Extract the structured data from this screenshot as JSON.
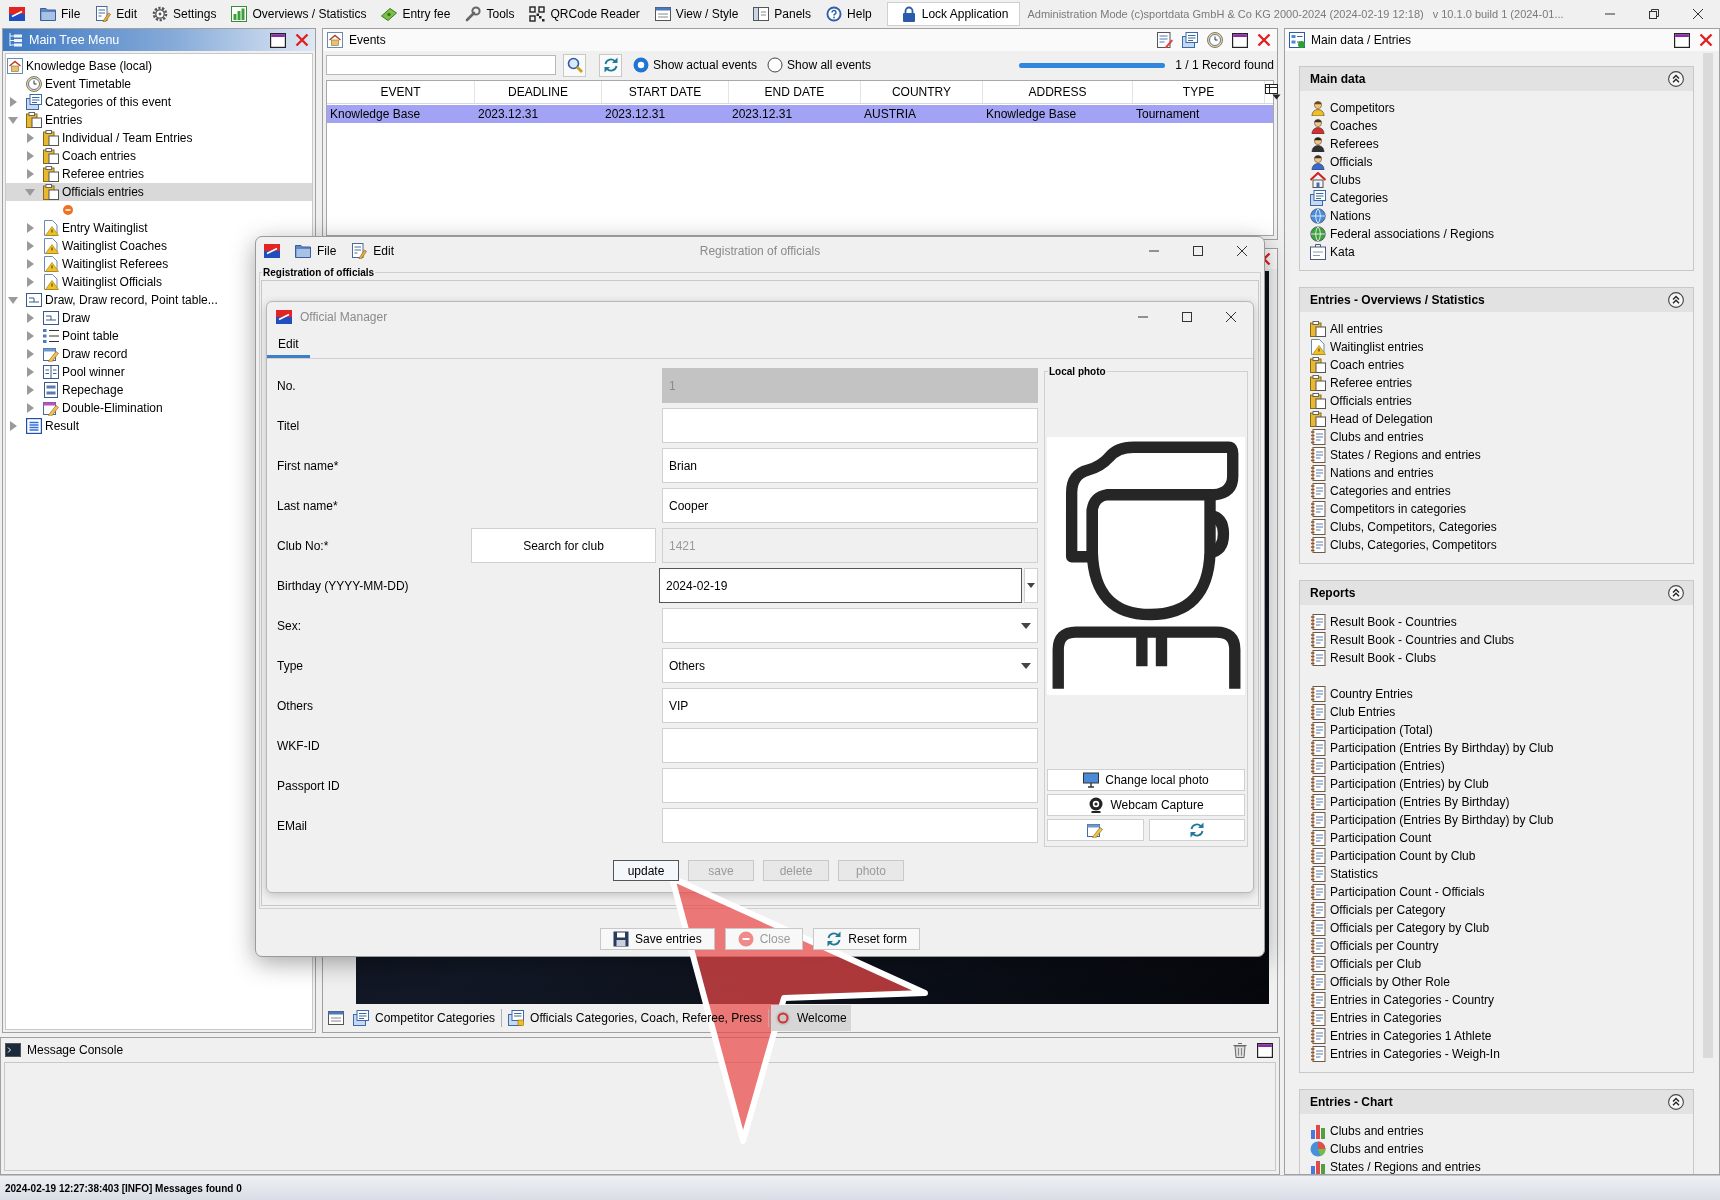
{
  "menu_bar": {
    "items": [
      "File",
      "Edit",
      "Settings",
      "Overviews / Statistics",
      "Entry fee",
      "Tools",
      "QRCode Reader",
      "View / Style",
      "Panels",
      "Help"
    ],
    "lock_button": "Lock Application",
    "mode_text": "Administration Mode (c)sportdata GmbH & Co KG 2000-2024 (2024-02-19 12:18)",
    "version_text": "v 10.1.0 build 1 (2024-01..."
  },
  "tree_panel": {
    "title": "Main Tree Menu",
    "nodes": [
      {
        "label": "Knowledge Base (local)",
        "selected": false,
        "children": [
          {
            "label": "Event Timetable",
            "selected": false
          },
          {
            "label": "Categories of this event",
            "selected": false,
            "expanded": false
          },
          {
            "label": "Entries",
            "selected": false,
            "expanded": true,
            "children": [
              {
                "label": "Individual / Team Entries",
                "selected": false,
                "expanded": false
              },
              {
                "label": "Coach entries",
                "selected": false,
                "expanded": false
              },
              {
                "label": "Referee entries",
                "selected": false,
                "expanded": false
              },
              {
                "label": "Officials entries",
                "selected": true,
                "expanded": true,
                "children": [
                  {
                    "selected": false
                  }
                ]
              },
              {
                "label": "Entry Waitinglist",
                "selected": false,
                "expanded": false
              },
              {
                "label": "Waitinglist Coaches",
                "selected": false,
                "expanded": false
              },
              {
                "label": "Waitinglist Referees",
                "selected": false,
                "expanded": false
              },
              {
                "label": "Waitinglist Officials",
                "selected": false,
                "expanded": false
              }
            ]
          },
          {
            "label": "Draw, Draw record, Point table...",
            "selected": false,
            "expanded": true,
            "children": [
              {
                "label": "Draw",
                "selected": false,
                "expanded": false
              },
              {
                "label": "Point table",
                "selected": false,
                "expanded": false
              },
              {
                "label": "Draw record",
                "selected": false,
                "expanded": false
              },
              {
                "label": "Pool winner",
                "selected": false,
                "expanded": false
              },
              {
                "label": "Repechage",
                "selected": false,
                "expanded": false
              },
              {
                "label": "Double-Elimination",
                "selected": false,
                "expanded": false
              }
            ]
          },
          {
            "label": "Result",
            "selected": false,
            "expanded": false
          }
        ]
      }
    ]
  },
  "events_panel": {
    "title": "Events",
    "radios": [
      {
        "label": "Show actual events",
        "selected": true
      },
      {
        "label": "Show all events",
        "selected": false
      }
    ],
    "progress": {
      "level": 1
    },
    "record_count": "1 / 1 Record found",
    "table": {
      "columns": [
        "EVENT",
        "DEADLINE",
        "START DATE",
        "END DATE",
        "COUNTRY",
        "ADDRESS",
        "TYPE"
      ],
      "rows": [
        {
          "cells": [
            "Knowledge Base",
            "2023.12.31",
            "2023.12.31",
            "2023.12.31",
            "AUSTRIA",
            "Knowledge Base",
            "Tournament"
          ],
          "selected": true
        }
      ]
    }
  },
  "document_tabs": [
    {
      "label": "Competitor Categories",
      "selected": false
    },
    {
      "label": "Officials Categories, Coach, Referee, Press",
      "selected": false
    },
    {
      "label": "Welcome",
      "selected": true
    }
  ],
  "message_console": {
    "title": "Message Console"
  },
  "status_bar": {
    "text": "2024-02-19 12:27:38:403 [INFO] Messages found 0"
  },
  "side_panel": {
    "title": "Main data / Entries",
    "sections": [
      {
        "title": "Main data",
        "expanded": true,
        "groups": [
          [
            "Competitors",
            "Coaches",
            "Referees",
            "Officials",
            "Clubs",
            "Categories",
            "Nations",
            "Federal associations / Regions",
            "Kata"
          ]
        ]
      },
      {
        "title": "Entries - Overviews / Statistics",
        "expanded": true,
        "groups": [
          [
            "All entries",
            "Waitinglist entries",
            "Coach entries",
            "Referee entries",
            "Officials entries",
            "Head of Delegation",
            "Clubs and entries",
            "States / Regions and entries",
            "Nations and entries",
            "Categories and entries",
            "Competitors in categories",
            "Clubs, Competitors, Categories",
            "Clubs, Categories, Competitors"
          ]
        ]
      },
      {
        "title": "Reports",
        "expanded": true,
        "groups": [
          [
            "Result Book - Countries",
            "Result Book - Countries and Clubs",
            "Result Book - Clubs"
          ],
          [
            "Country Entries",
            "Club Entries",
            "Participation (Total)",
            "Participation (Entries By Birthday) by Club",
            "Participation (Entries)",
            "Participation (Entries) by Club",
            "Participation (Entries By Birthday)",
            "Participation (Entries By Birthday) by Club",
            "Participation Count",
            "Participation Count by Club",
            "Statistics",
            "Participation Count - Officials",
            "Officials per Category",
            "Officials per Category by Club",
            "Officials per Country",
            "Officials per Club",
            "Officials by Other Role",
            "Entries in Categories - Country",
            "Entries in Categories",
            "Entries in Categories 1 Athlete",
            "Entries in Categories - Weigh-In"
          ]
        ]
      },
      {
        "title": "Entries - Chart",
        "expanded": true,
        "groups": [
          [
            "Clubs and entries",
            "Clubs and entries",
            "States / Regions and entries"
          ]
        ]
      }
    ]
  },
  "registration_dialog": {
    "menu": [
      "File",
      "Edit"
    ],
    "title": "Registration of officials",
    "group_label": "Registration of officials",
    "manager": {
      "title": "Official Manager",
      "tabs": [
        {
          "label": "Edit",
          "selected": true
        }
      ],
      "fields": [
        {
          "label": "No.",
          "kind": "text",
          "value": "1",
          "disabled": true,
          "focused": false
        },
        {
          "label": "Titel",
          "kind": "text",
          "disabled": false,
          "focused": false
        },
        {
          "label": "First name*",
          "kind": "text",
          "value": "Brian",
          "disabled": false,
          "focused": false
        },
        {
          "label": "Last name*",
          "kind": "text",
          "value": "Cooper",
          "disabled": false,
          "focused": false
        },
        {
          "label": "Club No:*",
          "kind": "club",
          "button": "Search for club",
          "value": "1421",
          "disabled": true,
          "focused": false
        },
        {
          "label": "Birthday (YYYY-MM-DD)",
          "kind": "date",
          "value": "2024-02-19",
          "disabled": false,
          "focused": true
        },
        {
          "label": "Sex:",
          "kind": "select",
          "disabled": false,
          "focused": false
        },
        {
          "label": "Type",
          "kind": "select",
          "value": "Others",
          "disabled": false,
          "focused": false
        },
        {
          "label": "Others",
          "kind": "text",
          "value": "VIP",
          "disabled": false,
          "focused": false
        },
        {
          "label": "WKF-ID",
          "kind": "text",
          "disabled": false,
          "focused": false
        },
        {
          "label": "Passport ID",
          "kind": "text",
          "disabled": false,
          "focused": false
        },
        {
          "label": "EMail",
          "kind": "text",
          "disabled": false,
          "focused": false
        }
      ],
      "photo": {
        "label": "Local photo",
        "buttons": [
          "Change local photo",
          "Webcam Capture"
        ]
      },
      "actions": [
        {
          "label": "update",
          "disabled": false,
          "focused": true
        },
        {
          "label": "save",
          "disabled": true,
          "focused": false
        },
        {
          "label": "delete",
          "disabled": true,
          "focused": false
        },
        {
          "label": "photo",
          "disabled": true,
          "focused": false
        }
      ]
    },
    "buttons": [
      {
        "label": "Save entries",
        "disabled": false
      },
      {
        "label": "Close",
        "disabled": true
      },
      {
        "label": "Reset form",
        "disabled": false
      }
    ]
  }
}
